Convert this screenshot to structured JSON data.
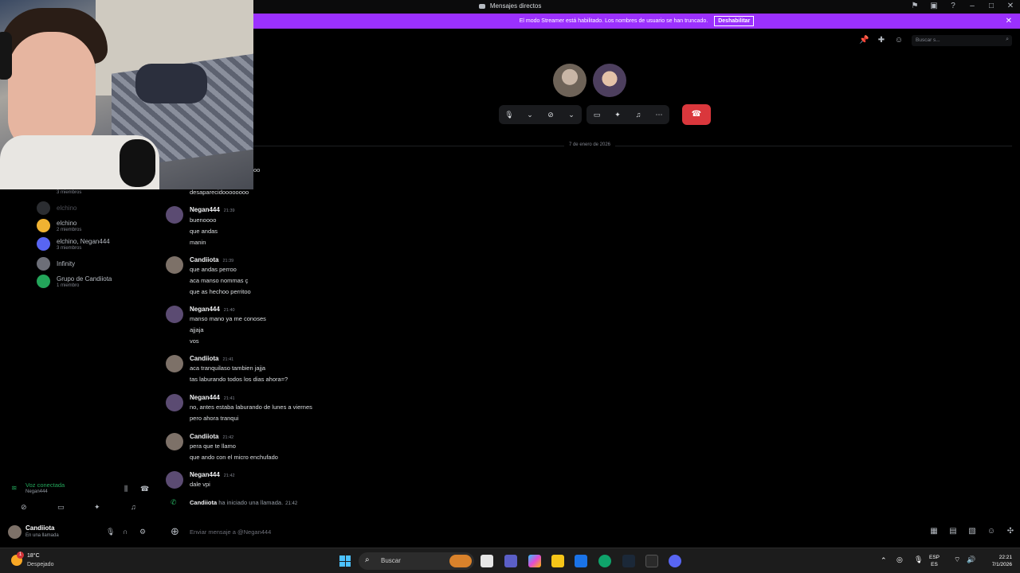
{
  "window": {
    "title": "Mensajes directos",
    "title_icons": [
      "flag-icon",
      "inbox-icon",
      "help-icon"
    ],
    "window_controls": [
      "minimize-icon",
      "maximize-icon",
      "close-icon"
    ]
  },
  "banner": {
    "text": "El modo Streamer está habilitado. Los nombres de usuario se han truncado.",
    "button_label": "Deshabilitar",
    "color": "#9b30ff"
  },
  "call": {
    "toolbar_icons": [
      "pin-icon",
      "add-friend-icon",
      "profile-icon"
    ],
    "search_placeholder": "Buscar s...",
    "participants": [
      {
        "name": "Candiiota",
        "color": "#8a7f77"
      },
      {
        "name": "Negan444",
        "color": "#7a6a8a"
      }
    ],
    "controls": [
      "microphone-icon",
      "camera-off-icon",
      "screen-share-icon",
      "activities-icon",
      "soundboard-icon",
      "more-icon"
    ],
    "hangup_icon": "hangup-icon",
    "hangup_color": "#da373c"
  },
  "sidebar": {
    "top_partial": "3 miembros",
    "dms": [
      {
        "name": "elchino",
        "sub": "",
        "color": "#2b2d31",
        "muted": true
      },
      {
        "name": "elchino",
        "sub": "2 miembros",
        "color": "#f0b232"
      },
      {
        "name": "elchino, Negan444",
        "sub": "3 miembros",
        "color": "#5865f2"
      },
      {
        "name": "Infinity",
        "sub": "",
        "color": "#6d6f78"
      },
      {
        "name": "Grupo de Candiiota",
        "sub": "1 miembro",
        "color": "#23a55a"
      }
    ],
    "voice": {
      "status": "Voz conectada",
      "channel": "Negan444",
      "color": "#23a55a"
    },
    "user": {
      "name": "Candiiota",
      "status": "En una llamada"
    }
  },
  "chat": {
    "date": "7 de enero de 2026",
    "partial_line_1": "oo",
    "partial_line_2": "desaparecidoooooooo",
    "messages": [
      {
        "author": "Negan444",
        "time": "21:39",
        "lines": [
          "buenoooo",
          "que andas",
          "manin"
        ]
      },
      {
        "author": "Candiiota",
        "time": "21:39",
        "lines": [
          "que andas perroo",
          "aca manso nommas ç",
          "que as hechoo perritoo"
        ]
      },
      {
        "author": "Negan444",
        "time": "21:40",
        "lines": [
          "manso mano ya me conoses",
          "ajjaja",
          "vos"
        ]
      },
      {
        "author": "Candiiota",
        "time": "21:41",
        "lines": [
          "aca tranquilaso tambien jajja",
          "tas laburando todos los dias ahora=?"
        ]
      },
      {
        "author": "Negan444",
        "time": "21:41",
        "lines": [
          "no, antes estaba laburando de lunes a viernes",
          "pero ahora tranqui"
        ]
      },
      {
        "author": "Candiiota",
        "time": "21:42",
        "lines": [
          "pera que te llamo",
          "que ando con el micro enchufado"
        ]
      },
      {
        "author": "Negan444",
        "time": "21:42",
        "lines": [
          "dale vpi"
        ]
      }
    ],
    "system": {
      "author": "Candiiota",
      "text": "ha iniciado una llamada.",
      "time": "21:42"
    },
    "composer_placeholder": "Enviar mensaje a @Negan444"
  },
  "taskbar": {
    "weather_temp": "18°C",
    "weather_cond": "Despejado",
    "weather_badge": "1",
    "search_label": "Buscar",
    "lang_1": "ESP",
    "lang_2": "ES",
    "time": "22:21",
    "date": "7/1/2026"
  }
}
